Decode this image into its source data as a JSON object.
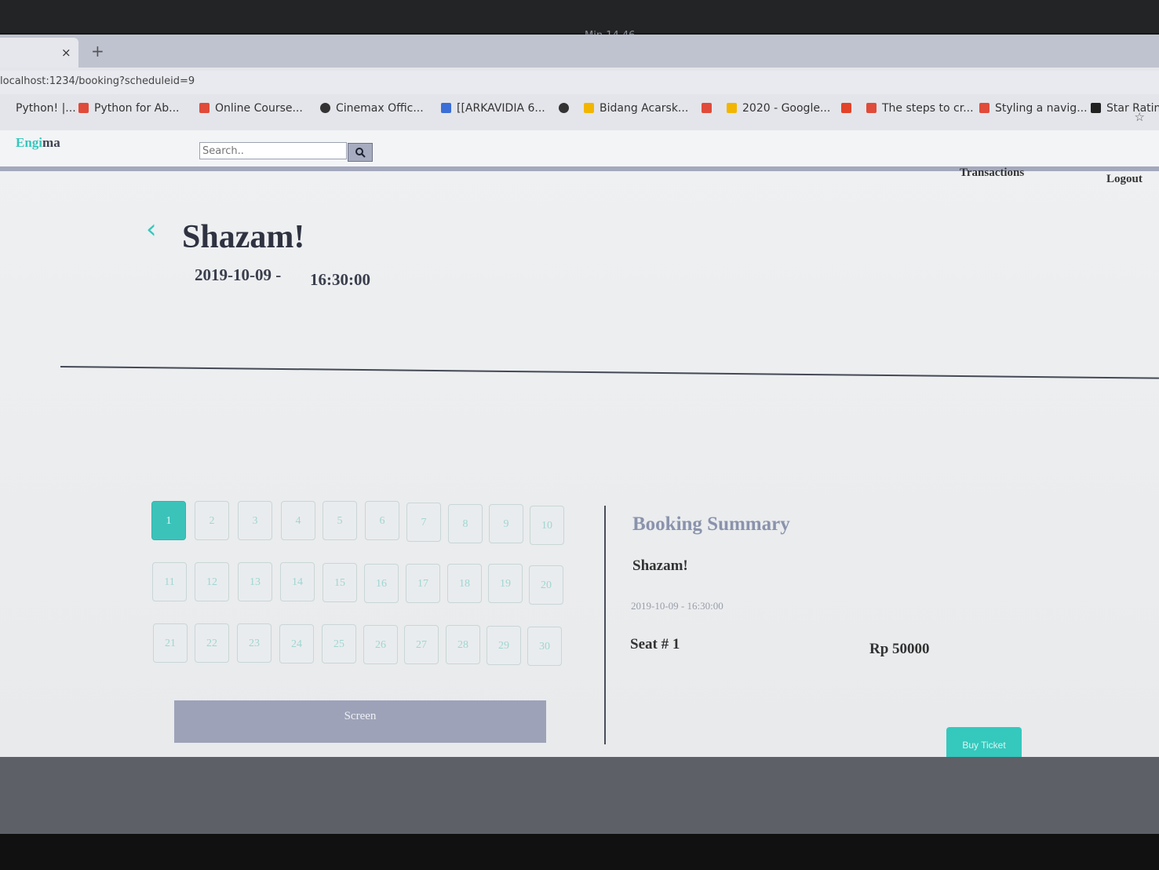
{
  "system": {
    "clock": "Min 14 46"
  },
  "browser": {
    "tab": {
      "close_glyph": "×",
      "new_tab_glyph": "+"
    },
    "url": "localhost:1234/booking?scheduleid=9",
    "bookmarks": [
      {
        "label": "Python! |...",
        "icon": "python-icon",
        "color": "#f0f0f0"
      },
      {
        "label": "Python for Ab...",
        "icon": "udemy-icon",
        "color": "#e04b3a"
      },
      {
        "label": "Online Course...",
        "icon": "udemy-icon",
        "color": "#e04b3a"
      },
      {
        "label": "Cinemax Offic...",
        "icon": "globe-icon",
        "color": "#333333"
      },
      {
        "label": "[[ARKAVIDIA 6...",
        "icon": "docs-icon",
        "color": "#3b6ed6"
      },
      {
        "label": "",
        "icon": "globe-icon",
        "color": "#333333"
      },
      {
        "label": "Bidang Acarsk...",
        "icon": "drive-icon",
        "color": "#f2b600"
      },
      {
        "label": "",
        "icon": "slides-icon",
        "color": "#e04b3a"
      },
      {
        "label": "2020 - Google...",
        "icon": "drive-icon",
        "color": "#f2b600"
      },
      {
        "label": "",
        "icon": "gitlab-icon",
        "color": "#e24329"
      },
      {
        "label": "The steps to cr...",
        "icon": "slides-icon",
        "color": "#e04b3a"
      },
      {
        "label": "Styling a navig...",
        "icon": "slides-icon",
        "color": "#e04b3a"
      },
      {
        "label": "Star Rating",
        "icon": "z-icon",
        "color": "#222222"
      }
    ]
  },
  "site": {
    "logo": {
      "part1": "Engi",
      "part2": "ma"
    },
    "search": {
      "placeholder": "Search.."
    },
    "nav": {
      "transactions": "Transactions",
      "logout": "Logout"
    },
    "back_glyph": "‹",
    "movie": {
      "title": "Shazam!",
      "date": "2019-10-09 -",
      "time": "16:30:00"
    },
    "seats": {
      "rows": [
        [
          "1",
          "2",
          "3",
          "4",
          "5",
          "6",
          "7",
          "8",
          "9",
          "10"
        ],
        [
          "11",
          "12",
          "13",
          "14",
          "15",
          "16",
          "17",
          "18",
          "19",
          "20"
        ],
        [
          "21",
          "22",
          "23",
          "24",
          "25",
          "26",
          "27",
          "28",
          "29",
          "30"
        ]
      ],
      "selected": "1"
    },
    "screen_label": "Screen",
    "summary": {
      "title": "Booking Summary",
      "movie": "Shazam!",
      "datetime": "2019-10-09 - 16:30:00",
      "seat": "Seat # 1",
      "price": "Rp 50000",
      "buy_label": "Buy Ticket"
    },
    "colors": {
      "accent": "#35c8bd",
      "nav_border": "#a3a8bd",
      "screen": "#9da2b8"
    }
  }
}
